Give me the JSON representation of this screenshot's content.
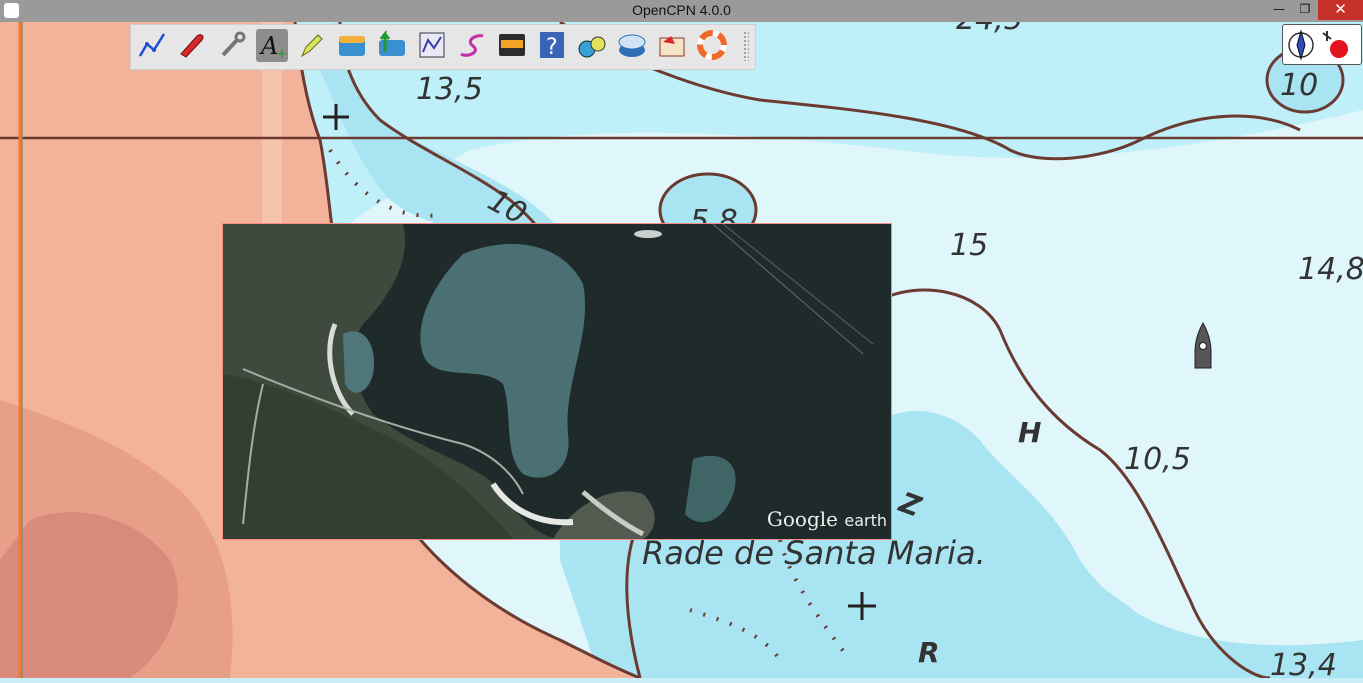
{
  "window": {
    "title": "OpenCPN 4.0.0",
    "minimize_glyph": "—",
    "restore_glyph": "❐",
    "close_glyph": "✕"
  },
  "toolbar": {
    "tools": [
      {
        "name": "route-icon"
      },
      {
        "name": "ais-target-icon"
      },
      {
        "name": "settings-wrench-icon"
      },
      {
        "name": "text-annotation-icon",
        "active": true
      },
      {
        "name": "mark-pen-icon"
      },
      {
        "name": "tide-icon"
      },
      {
        "name": "current-icon"
      },
      {
        "name": "route-manager-icon"
      },
      {
        "name": "track-icon"
      },
      {
        "name": "dashboard-icon"
      },
      {
        "name": "help-icon"
      },
      {
        "name": "zoom-chart-icon"
      },
      {
        "name": "gps-position-icon"
      },
      {
        "name": "alarm-icon"
      },
      {
        "name": "life-ring-icon"
      }
    ]
  },
  "chart": {
    "soundings": [
      "13,5",
      "10",
      "5,8",
      "15",
      "14,8",
      "10,5",
      "13,4",
      "10",
      "24,5"
    ],
    "letters": [
      "H",
      "R",
      "Z"
    ],
    "place_name": "Rade de Santa Maria."
  },
  "overlay": {
    "logo_text": "Google",
    "logo_suffix": "earth"
  },
  "colors": {
    "land": "#f2b39a",
    "shallow_water": "#a9e4f3",
    "deep_water": "#dff6fb",
    "depth_contour": "#6b3b32",
    "selected_tool": "#8d8d8d",
    "close_button": "#c7312b"
  }
}
